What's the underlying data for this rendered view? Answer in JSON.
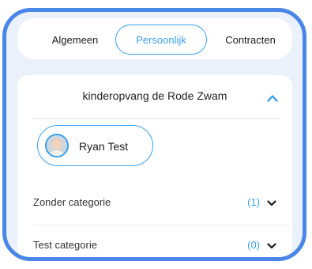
{
  "tabs": [
    {
      "label": "Algemeen"
    },
    {
      "label": "Persoonlijk"
    },
    {
      "label": "Contracten"
    }
  ],
  "organization": {
    "name": "kinderopvang de Rode Zwam"
  },
  "person": {
    "name": "Ryan Test"
  },
  "categories": [
    {
      "label": "Zonder categorie",
      "count": "(1)"
    },
    {
      "label": "Test categorie",
      "count": "(0)"
    }
  ],
  "colors": {
    "accent": "#38a1ef",
    "frame": "#4a86e8",
    "background": "#eaf1fb"
  },
  "icons": {
    "expand": "chevron-up-icon",
    "collapse": "chevron-down-icon",
    "avatar": "child-photo"
  }
}
